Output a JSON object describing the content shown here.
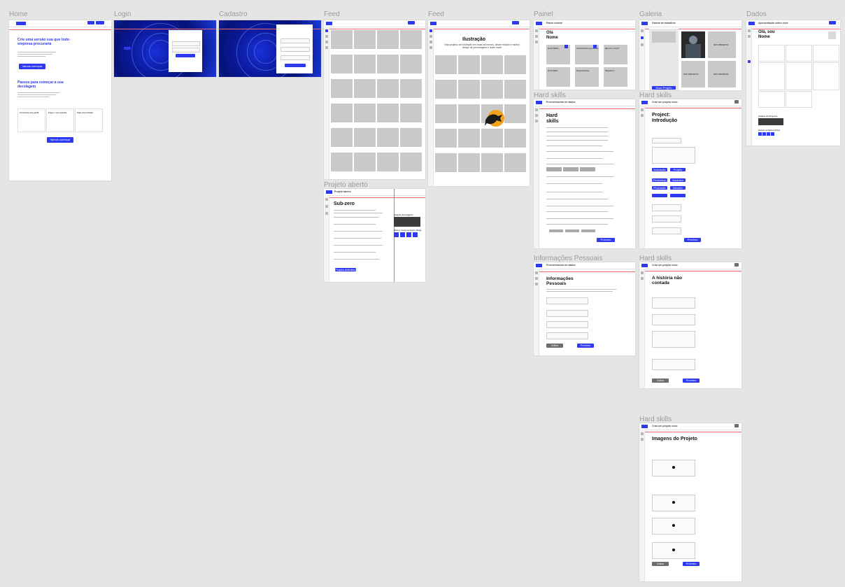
{
  "labels": {
    "home": "Home",
    "login": "Login",
    "cadastro": "Cadastro",
    "feed1": "Feed",
    "feed2": "Feed",
    "painel": "Painel",
    "galeria": "Galeria",
    "dados": "Dados",
    "projeto_aberto": "Projeto aberto",
    "hard1": "Hard skills",
    "hard2": "Hard skills",
    "hard3": "Hard skills",
    "hard4": "Hard skills",
    "info": "Informações Pessoais"
  },
  "home": {
    "headline": "Crie uma versão sua que todo empresa procuraria",
    "cta": "Vamos começar",
    "steps_title": "Passos para começar a sua decolagem",
    "card1": "Construa seu perfil",
    "card2": "Faça o seu upload",
    "card3": "Seja encontrado",
    "cta2": "Vamos começar"
  },
  "feed2": {
    "title": "Ilustração",
    "subtitle": "Veja projetos de ilustração em todas as formas, desde edução e muitos design de personagens e muito mais!"
  },
  "painel": {
    "header": "Painel central",
    "greeting": "Olá Nome",
    "c1": "Hard Skills",
    "c2": "Informações pessoais",
    "c3": "Quem é você?",
    "c4": "Soft Skills",
    "c5": "Experiências",
    "c6": "Objetivos"
  },
  "galeria": {
    "header": "Galeria de trabalhos",
    "p1": "SEU PROJETO",
    "p2": "SEU PROJETO",
    "p3": "SEU PROJETO",
    "p4": "SEU PROJETO",
    "add": "Novo Projeto"
  },
  "dados": {
    "header": "Apresentação sobre você",
    "greeting": "Olá, sou Nome",
    "gallery": "Galeria de Projetos",
    "more": "Outros projetos (foto)"
  },
  "projeto": {
    "header": "Projeto aberto",
    "title": "Sub-zero",
    "gallery": "Galeria de imagens",
    "others": "Outros meus projetos (fina)",
    "btn": "Projeto definitivo"
  },
  "hard_skills": {
    "header": "Preenchimento de dados",
    "title": "Hard skills",
    "submit": "Próximo"
  },
  "intro": {
    "header": "Criar um projeto novo",
    "title": "Project: Introdução",
    "b1": "Ilustração",
    "b2": "Projeto pessoal",
    "b3": "Photoshop",
    "b4": "Illustrator",
    "b5": "Procreate",
    "b6": "Blender",
    "submit": "Próximo"
  },
  "info": {
    "header": "Preenchimento de dados",
    "title": "Informações Pessoais",
    "back": "Voltar",
    "next": "Próximo"
  },
  "historia": {
    "header": "Criar um projeto novo",
    "title": "A história não contada",
    "back": "Voltar",
    "next": "Próximo"
  },
  "imagens": {
    "header": "Criar um projeto novo",
    "title": "Imagens do Projeto",
    "back": "Voltar",
    "next": "Próximo"
  }
}
